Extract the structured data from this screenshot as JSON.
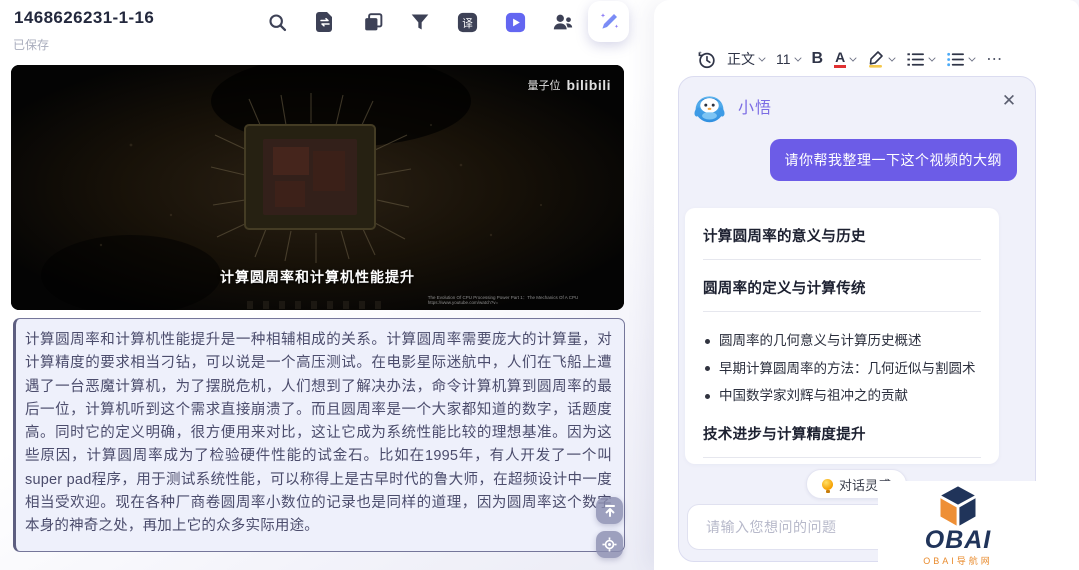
{
  "header": {
    "title": "1468626231-1-16",
    "save_status": "已保存"
  },
  "video": {
    "watermark_channel": "量子位",
    "watermark_site": "bilibili",
    "caption": "计算圆周率和计算机性能提升",
    "credit_title": "The Evolution Of CPU Processing Power Part 1：The Mechanics Of A CPU",
    "credit_url": "https://www.youtube.com/watch?v="
  },
  "transcript": {
    "text": "计算圆周率和计算机性能提升是一种相辅相成的关系。计算圆周率需要庞大的计算量，对计算精度的要求相当刁钻，可以说是一个高压测试。在电影星际迷航中，人们在飞船上遭遇了一台恶魔计算机，为了摆脱危机，人们想到了解决办法，命令计算机算到圆周率的最后一位，计算机听到这个需求直接崩溃了。而且圆周率是一个大家都知道的数字，话题度高。同时它的定义明确，很方便用来对比，这让它成为系统性能比较的理想基准。因为这些原因，计算圆周率成为了检验硬件性能的试金石。比如在1995年，有人开发了一个叫super pad程序，用于测试系统性能，可以称得上是古早时代的鲁大师，在超频设计中一度相当受欢迎。现在各种厂商卷圆周率小数位的记录也是同样的道理，因为圆周率这个数字本身的神奇之处，再加上它的众多实际用途。"
  },
  "editor_toolbar": {
    "paragraph_style": "正文",
    "font_size": "11",
    "bold_label": "B",
    "color_label": "A",
    "more_label": "⋯"
  },
  "assistant": {
    "name": "小悟",
    "close_label": "✕",
    "user_message": "请你帮我整理一下这个视频的大纲",
    "outline": {
      "sections": [
        {
          "heading": "计算圆周率的意义与历史"
        },
        {
          "heading": "圆周率的定义与计算传统",
          "bullets": [
            "圆周率的几何意义与计算历史概述",
            "早期计算圆周率的方法：几何近似与割圆术",
            "中国数学家刘辉与祖冲之的贡献"
          ]
        },
        {
          "heading": "技术进步与计算精度提升"
        }
      ]
    },
    "suggestion_pill": "对话灵感",
    "input_placeholder": "请输入您想问的问题"
  },
  "site_watermark": {
    "brand": "OBAI",
    "subtitle": "OBAI导航网"
  },
  "colors": {
    "accent_purple": "#6c5ce7",
    "indigo_icon": "#6366f1",
    "icon_dark": "#3d4156",
    "navy": "#20345a",
    "orange": "#ee8f35"
  }
}
